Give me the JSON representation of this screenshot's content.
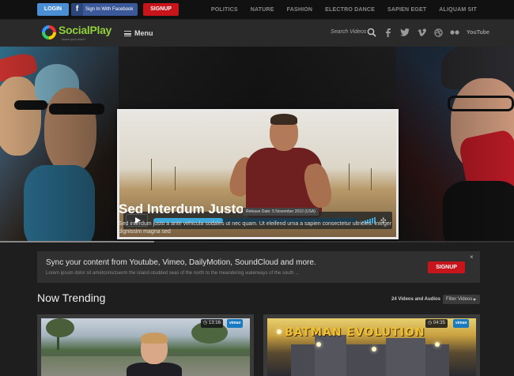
{
  "topbar": {
    "login_label": "LOGIN",
    "facebook_label": "Sign In With Facebook",
    "signup_label": "SIGNUP",
    "nav": [
      "POLITICS",
      "NATURE",
      "FASHION",
      "ELECTRO DANCE",
      "SAPIEN EGET",
      "ALIQUAM SIT"
    ]
  },
  "header": {
    "logo_text": "SocialPlay",
    "logo_tagline": "share your world",
    "menu_label": "Menu",
    "search_placeholder": "Search Videos",
    "social_icons": [
      "facebook-icon",
      "twitter-icon",
      "vimeo-icon",
      "dribbble-icon",
      "flickr-icon",
      "youtube-icon"
    ],
    "youtube_label": "YouTube"
  },
  "hero": {
    "title": "Sed Interdum Justo",
    "release": "Release Date: 5 November 2010 (USA)",
    "description": "Sed interdum justo a ante vehicula sodales ut nec quam. Ut eleifend urna a sapien consectetur ultricies. Integer dignissim magna sed",
    "player_progress": 0.34,
    "slider_progress": 0.3
  },
  "sync": {
    "title": "Sync your content from Youtube, Vimeo, DailyMotion, SoundCloud and more.",
    "subtitle": "Lorem ipsum dolor sit ametconsctuerm the island-studded seas of the north to the meandering waterways of the south ...",
    "button_label": "SIGNUP",
    "close_label": "×"
  },
  "trending": {
    "title": "Now Trending",
    "count": "24 Videos and Audios",
    "filter_label": "Filter Videos",
    "cards": [
      {
        "duration": "13:16",
        "provider": "vimeo"
      },
      {
        "duration": "04:35",
        "provider": "vimeo",
        "overlay_text": "BATMAN EVOLUTION"
      }
    ]
  },
  "colors": {
    "accent_red": "#c8141b",
    "login_blue": "#4a8fd4",
    "facebook_blue": "#3b5998",
    "progress_blue": "#3ba6d8",
    "logo_green": "#8fcf3c"
  }
}
